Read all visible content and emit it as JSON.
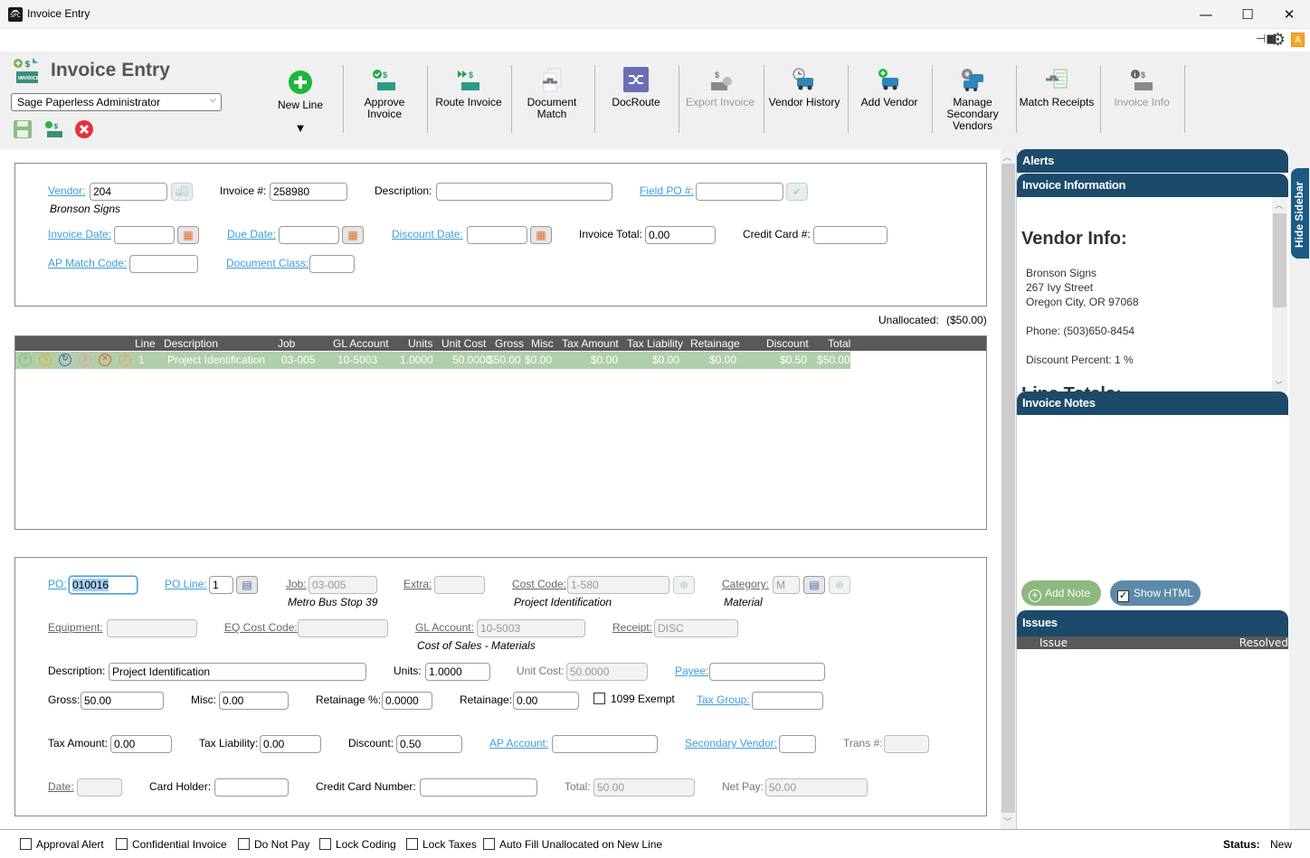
{
  "window": {
    "title": "Invoice Entry",
    "minimize": "—",
    "maximize": "☐",
    "close": "✕"
  },
  "header": {
    "title": "Invoice Entry",
    "user_select": "Sage Paperless Administrator"
  },
  "toolbar": {
    "new_line": "New Line",
    "new_line_dropdown": "▼",
    "approve_invoice": "Approve Invoice",
    "route_invoice": "Route Invoice",
    "document_match": "Document Match",
    "docroute": "DocRoute",
    "export_invoice": "Export Invoice",
    "vendor_history": "Vendor History",
    "add_vendor": "Add Vendor",
    "manage_secondary_vendors": "Manage Secondary Vendors",
    "match_receipts": "Match Receipts",
    "invoice_info": "Invoice Info"
  },
  "header_form": {
    "vendor_label": "Vendor:",
    "vendor_value": "204",
    "vendor_name": "Bronson Signs",
    "invoice_no_label": "Invoice #:",
    "invoice_no_value": "258980",
    "description_label": "Description:",
    "description_value": "",
    "field_po_label": "Field PO #:",
    "field_po_value": "",
    "invoice_date_label": "Invoice Date:",
    "due_date_label": "Due Date:",
    "discount_date_label": "Discount Date:",
    "invoice_total_label": "Invoice Total:",
    "invoice_total_value": "0.00",
    "credit_card_label": "Credit Card #:",
    "ap_match_code_label": "AP Match Code:",
    "document_class_label": "Document Class:"
  },
  "unallocated": {
    "label": "Unallocated:",
    "value": "($50.00)"
  },
  "grid": {
    "columns": [
      "Line",
      "Description",
      "Job",
      "GL Account",
      "Units",
      "Unit Cost",
      "Gross",
      "Misc",
      "Tax Amount",
      "Tax Liability",
      "Retainage",
      "Discount",
      "Total"
    ],
    "rows": [
      {
        "line": "1",
        "description": "Project Identification",
        "job": "03-005",
        "gl_account": "10-5003",
        "units": "1.0000",
        "unit_cost": "50.0000",
        "gross": "$50.00",
        "misc": "$0.00",
        "tax_amount": "$0.00",
        "tax_liability": "$0.00",
        "retainage": "$0.00",
        "discount": "$0.50",
        "total": "$50.00"
      }
    ]
  },
  "line_form": {
    "po_label": "PO:",
    "po_value": "010016",
    "po_line_label": "PO Line:",
    "po_line_value": "1",
    "job_label": "Job:",
    "job_value": "03-005",
    "job_name": "Metro Bus Stop 39",
    "extra_label": "Extra:",
    "cost_code_label": "Cost Code:",
    "cost_code_value": "1-580",
    "cost_code_name": "Project Identification",
    "category_label": "Category:",
    "category_value": "M",
    "category_name": "Material",
    "equipment_label": "Equipment:",
    "eq_cost_code_label": "EQ Cost Code:",
    "gl_account_label": "GL Account:",
    "gl_account_value": "10-5003",
    "gl_account_name": "Cost of Sales - Materials",
    "receipt_label": "Receipt:",
    "receipt_value": "DISC",
    "description_label": "Description:",
    "description_value": "Project Identification",
    "units_label": "Units:",
    "units_value": "1.0000",
    "unit_cost_label": "Unit Cost:",
    "unit_cost_value": "50.0000",
    "payee_label": "Payee:",
    "gross_label": "Gross:",
    "gross_value": "50.00",
    "misc_label": "Misc:",
    "misc_value": "0.00",
    "retainage_pct_label": "Retainage %:",
    "retainage_pct_value": "0.0000",
    "retainage_label": "Retainage:",
    "retainage_value": "0.00",
    "exempt_1099_label": "1099 Exempt",
    "tax_group_label": "Tax Group:",
    "tax_amount_label": "Tax Amount:",
    "tax_amount_value": "0.00",
    "tax_liability_label": "Tax Liability:",
    "tax_liability_value": "0.00",
    "discount_label": "Discount:",
    "discount_value": "0.50",
    "ap_account_label": "AP Account:",
    "secondary_vendor_label": "Secondary Vendor:",
    "trans_label": "Trans #:",
    "date_label": "Date:",
    "card_holder_label": "Card Holder:",
    "credit_card_number_label": "Credit Card Number:",
    "total_label": "Total:",
    "total_value": "50.00",
    "net_pay_label": "Net Pay:",
    "net_pay_value": "50.00"
  },
  "sidebar": {
    "alerts": "Alerts",
    "invoice_information": "Invoice Information",
    "vendor_info_title": "Vendor Info:",
    "vendor_name": "Bronson Signs",
    "vendor_street": "267 Ivy Street",
    "vendor_city": "Oregon City, OR 97068",
    "vendor_phone": "Phone: (503)650-8454",
    "vendor_discount": "Discount Percent: 1 %",
    "line_totals_partial": "Line Totals:",
    "invoice_notes": "Invoice Notes",
    "add_note": "Add Note",
    "show_html": "Show HTML",
    "show_html_checked": true,
    "issues": "Issues",
    "issues_columns": [
      "Issue",
      "Resolved"
    ],
    "hide_sidebar": "Hide Sidebar"
  },
  "footer": {
    "checkboxes": [
      "Approval Alert",
      "Confidential Invoice",
      "Do Not Pay",
      "Lock Coding",
      "Lock Taxes",
      "Auto Fill Unallocated on New Line"
    ],
    "status_label": "Status:",
    "status_value": "New"
  },
  "colors": {
    "accent_link": "#3d9fd8",
    "panel_header": "#1b4a6b",
    "grid_row": "#b0ceaa",
    "grid_header": "#595959"
  }
}
